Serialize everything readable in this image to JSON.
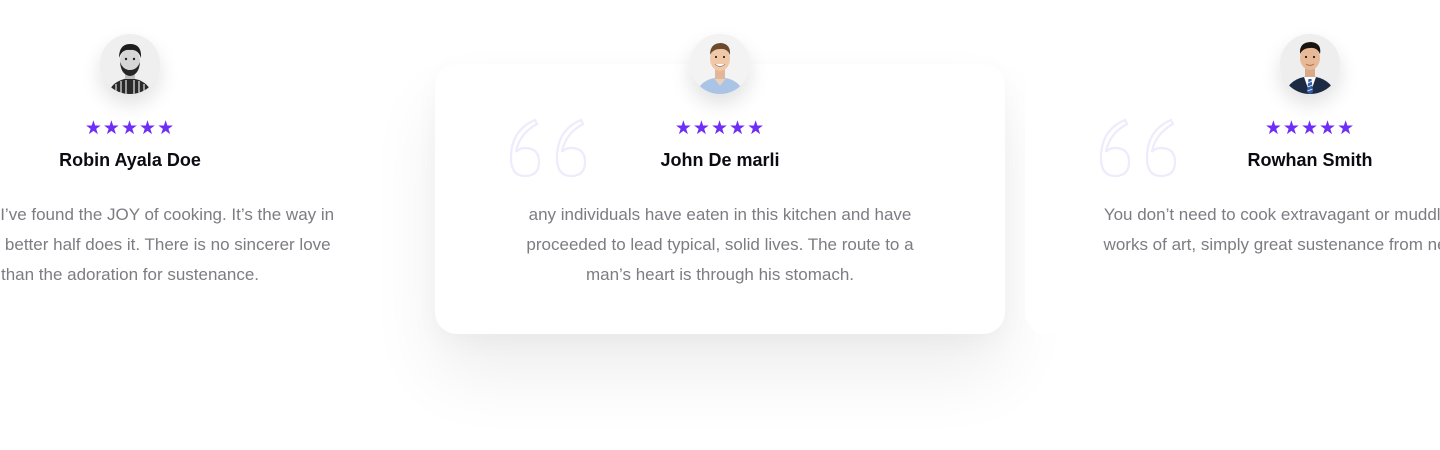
{
  "testimonials": [
    {
      "name": "Robin Ayala Doe",
      "text": "Honestly, I’ve found the JOY of cooking. It’s the way in which my better half does it. There is no sincerer love than the adoration for sustenance.",
      "rating": 5,
      "avatar_icon": "bearded-man-avatar"
    },
    {
      "name": "John De marli",
      "text": "any individuals have eaten in this kitchen and have proceeded to lead typical, solid lives. The route to a man’s heart is through his stomach.",
      "rating": 5,
      "avatar_icon": "smiling-man-avatar"
    },
    {
      "name": "Rowhan Smith",
      "text": "You don’t need to cook extravagant or muddled perfect works of art, simply great sustenance from new fixings.",
      "rating": 5,
      "avatar_icon": "suited-man-avatar"
    }
  ],
  "colors": {
    "star": "#6f2ef6",
    "quote": "#eeebfc",
    "name": "#0b0b12",
    "text": "#7c7c82"
  }
}
